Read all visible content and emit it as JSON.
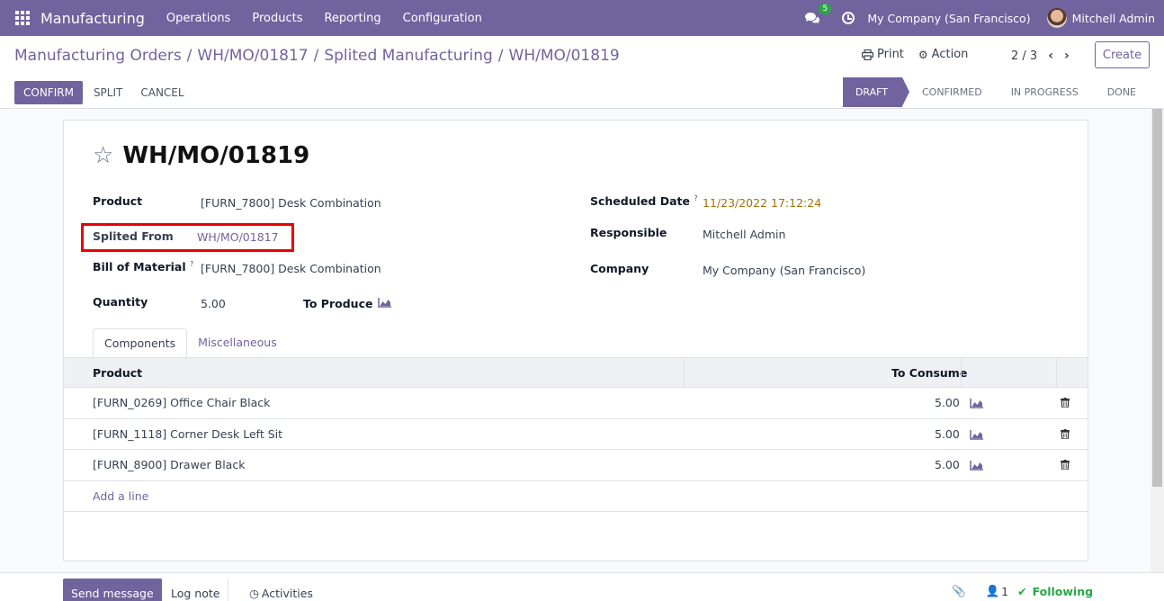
{
  "navbar": {
    "app_name": "Manufacturing",
    "menu": [
      "Operations",
      "Products",
      "Reporting",
      "Configuration"
    ],
    "chat_count": "5",
    "company": "My Company (San Francisco)",
    "user": "Mitchell Admin"
  },
  "breadcrumb": {
    "items": [
      "Manufacturing Orders",
      "WH/MO/01817",
      "Splited Manufacturing"
    ],
    "current": "WH/MO/01819",
    "separator": "/"
  },
  "control": {
    "print_label": "Print",
    "action_label": "Action",
    "pager": "2 / 3",
    "create_label": "Create"
  },
  "buttons": {
    "confirm": "CONFIRM",
    "split": "SPLIT",
    "cancel": "CANCEL"
  },
  "stages": [
    "DRAFT",
    "CONFIRMED",
    "IN PROGRESS",
    "DONE"
  ],
  "form": {
    "title": "WH/MO/01819",
    "product_label": "Product",
    "product_value": "[FURN_7800] Desk Combination",
    "splited_from_label": "Splited From",
    "splited_from_value": "WH/MO/01817",
    "bom_label": "Bill of Material",
    "bom_help": "?",
    "bom_value": "[FURN_7800] Desk Combination",
    "quantity_label": "Quantity",
    "quantity_value": "5.00",
    "to_produce_label": "To Produce",
    "scheduled_label": "Scheduled Date",
    "scheduled_help": "?",
    "scheduled_value": "11/23/2022 17:12:24",
    "responsible_label": "Responsible",
    "responsible_value": "Mitchell Admin",
    "company_label": "Company",
    "company_value": "My Company (San Francisco)"
  },
  "tabs": [
    "Components",
    "Miscellaneous"
  ],
  "components": {
    "headers": [
      "Product",
      "To Consume"
    ],
    "rows": [
      {
        "product": "[FURN_0269] Office Chair Black",
        "qty": "5.00"
      },
      {
        "product": "[FURN_1118] Corner Desk Left Sit",
        "qty": "5.00"
      },
      {
        "product": "[FURN_8900] Drawer Black",
        "qty": "5.00"
      }
    ],
    "add_line": "Add a line"
  },
  "chatter": {
    "send_message": "Send message",
    "log_note": "Log note",
    "activities": "Activities",
    "followers_count": "1",
    "following": "Following"
  },
  "colors": {
    "brand": "#71639e",
    "date": "#a0720a",
    "following": "#28a745",
    "highlight": "#e00000"
  }
}
